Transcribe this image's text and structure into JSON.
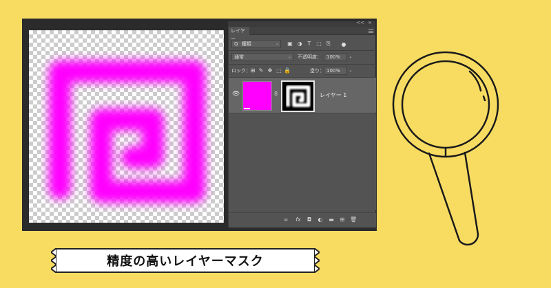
{
  "panel": {
    "tab_label": "レイヤー",
    "collapse_glyph": "<<",
    "close_glyph": "×",
    "filter": {
      "search_glyph": "Q",
      "kind_label": "種類",
      "dropdown_glyph": "⌄"
    },
    "blend_mode": "通常",
    "opacity_label": "不透明度：",
    "opacity_value": "100%",
    "lock_label": "ロック：",
    "fill_label": "塗り：",
    "fill_value": "100%",
    "layer": {
      "name": "レイヤー 1",
      "thumb_color": "#ff00ff",
      "visible_glyph": "👁",
      "link_glyph": "8"
    },
    "bottom_icons": [
      "link-layers-icon",
      "fx-icon",
      "mask-icon",
      "adjustment-icon",
      "group-icon",
      "new-layer-icon",
      "trash-icon"
    ],
    "bottom_glyphs": {
      "link": "∞",
      "fx": "fx",
      "mask": "◘",
      "adjust": "◐",
      "group": "▬",
      "new": "⊞",
      "trash": "🗑"
    },
    "filter_glyphs": {
      "image": "▣",
      "adjust": "◑",
      "type": "T",
      "shape": "⬚",
      "smart": "⎘"
    },
    "lock_glyphs": {
      "pixels": "⊞",
      "paint": "✎",
      "move": "✥",
      "artboard": "⬚",
      "all": "🔒"
    }
  },
  "caption": {
    "text": "精度の高いレイヤーマスク"
  },
  "colors": {
    "background": "#f8dc62",
    "accent": "#ff00ff",
    "panel_bg": "#535353"
  }
}
